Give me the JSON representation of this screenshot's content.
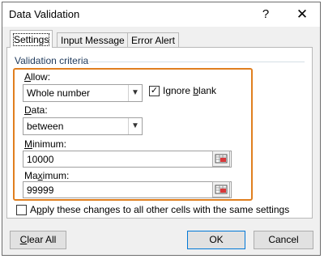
{
  "window": {
    "title": "Data Validation",
    "help_glyph": "?",
    "close_glyph": "✕"
  },
  "tabs": [
    {
      "label": "Settings",
      "active": true
    },
    {
      "label": "Input Message",
      "active": false
    },
    {
      "label": "Error Alert",
      "active": false
    }
  ],
  "criteria": {
    "group_title": "Validation criteria",
    "allow": {
      "label_mnemonic": "A",
      "label_rest": "llow:",
      "value": "Whole number"
    },
    "ignore_blank": {
      "label_pre": "Ignore ",
      "label_mnemonic": "b",
      "label_post": "lank",
      "checked": true
    },
    "data": {
      "label_mnemonic": "D",
      "label_rest": "ata:",
      "value": "between"
    },
    "minimum": {
      "label_mnemonic": "M",
      "label_rest": "inimum:",
      "value": "10000"
    },
    "maximum": {
      "label_pre": "Ma",
      "label_mnemonic": "x",
      "label_post": "imum:",
      "value": "99999"
    }
  },
  "apply_all": {
    "label_pre": "A",
    "label_mnemonic": "p",
    "label_post": "ply these changes to all other cells with the same settings",
    "checked": false
  },
  "buttons": {
    "clear_all": {
      "mnemonic": "C",
      "rest": "lear All"
    },
    "ok": "OK",
    "cancel": "Cancel"
  },
  "colors": {
    "highlight_box": "#e07f1f",
    "group_title": "#1e395b",
    "dialog_bg": "#f0f0f0"
  }
}
